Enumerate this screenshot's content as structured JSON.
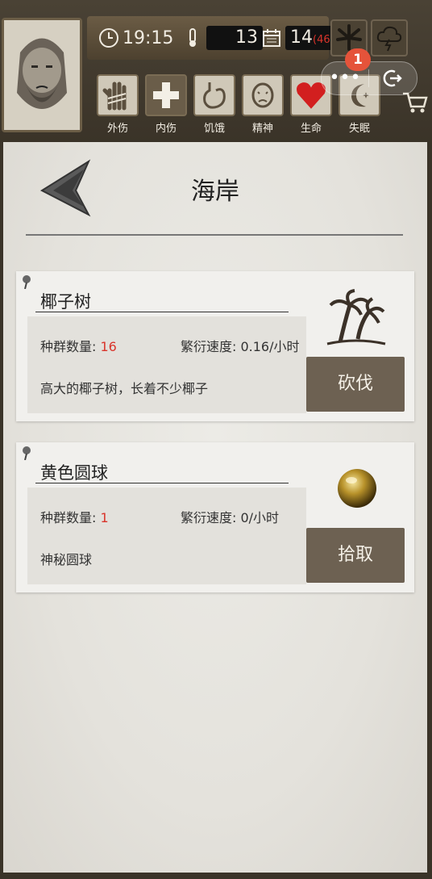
{
  "hud": {
    "time": "19:15",
    "temperature": "13",
    "day": "14",
    "day_extra": "(46)",
    "notification_count": "1",
    "status": [
      {
        "label": "外伤",
        "icon": "bandaged-hand-icon"
      },
      {
        "label": "内伤",
        "icon": "cross-icon"
      },
      {
        "label": "饥饿",
        "icon": "stomach-icon"
      },
      {
        "label": "精神",
        "icon": "head-icon"
      },
      {
        "label": "生命",
        "icon": "heart-icon"
      },
      {
        "label": "失眠",
        "icon": "moon-icon"
      }
    ],
    "colors": {
      "life": "#d21f1f",
      "badge": "#e5533a"
    }
  },
  "page": {
    "title": "海岸"
  },
  "resources": [
    {
      "name": "椰子树",
      "population_label": "种群数量: ",
      "population": "16",
      "rate_label": "繁衍速度: ",
      "rate": "0.16/小时",
      "description": "高大的椰子树，长着不少椰子",
      "action": "砍伐",
      "icon": "palm-tree-icon"
    },
    {
      "name": "黄色圆球",
      "population_label": "种群数量: ",
      "population": "1",
      "rate_label": "繁衍速度: ",
      "rate": "0/小时",
      "description": "神秘圆球",
      "action": "拾取",
      "icon": "golden-orb-icon"
    }
  ]
}
